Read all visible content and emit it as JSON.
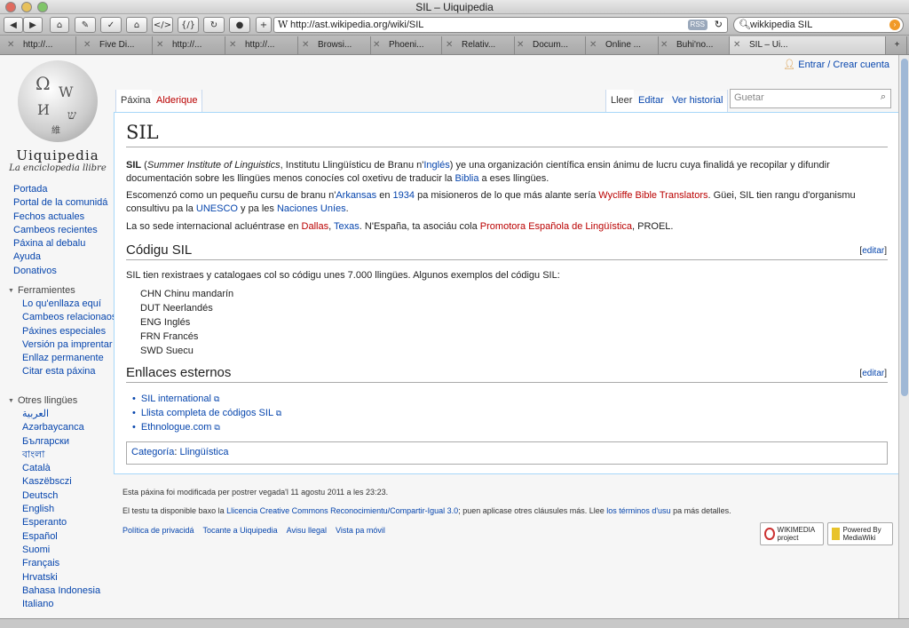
{
  "window": {
    "title": "SIL – Uiquipedia"
  },
  "toolbar": {
    "url": "http://ast.wikipedia.org/wiki/SIL",
    "search": "wikkipedia SIL",
    "rss": "RSS"
  },
  "tabs": [
    "http://...",
    "Five Di...",
    "http://...",
    "http://...",
    "Browsi...",
    "Phoeni...",
    "Relativ...",
    "Docum...",
    "Online ...",
    "Buhi'no...",
    "SIL – Ui..."
  ],
  "sidebar": {
    "logo_name": "Uiquipedia",
    "logo_tag": "La enciclopedia llibre",
    "nav": [
      "Portada",
      "Portal de la comunidá",
      "Fechos actuales",
      "Cambeos recientes",
      "Páxina al debalu",
      "Ayuda",
      "Donativos"
    ],
    "tools_heading": "Ferramientes",
    "tools": [
      "Lo qu'enllaza equí",
      "Cambeos relacionaos",
      "Páxines especiales",
      "Versión pa imprentar",
      "Enllaz permanente",
      "Citar esta páxina"
    ],
    "langs_heading": "Otres llingües",
    "langs": [
      "العربية",
      "Azərbaycanca",
      "Български",
      "বাংলা",
      "Català",
      "Kaszëbsczi",
      "Deutsch",
      "English",
      "Esperanto",
      "Español",
      "Suomi",
      "Français",
      "Hrvatski",
      "Bahasa Indonesia",
      "Italiano"
    ]
  },
  "usertools": {
    "login": "Entrar / Crear cuenta"
  },
  "page_tabs": {
    "page": "Páxina",
    "talk": "Alderique",
    "read": "Lleer",
    "edit": "Editar",
    "history": "Ver historial",
    "search_placeholder": "Guetar"
  },
  "article": {
    "title": "SIL",
    "intro_1": {
      "b": "SIL",
      "a": " (",
      "i": "Summer Institute of Linguistics",
      "c": ", Institutu Llingüísticu de Branu n'",
      "l1": "Inglés",
      "d": ") ye una organización científica ensin ánimu de lucru cuya finalidá ye recopilar y difundir documentación sobre les llingües menos conocíes col oxetivu de traducir la ",
      "l2": "Biblia",
      "e": " a eses llingües."
    },
    "intro_2": {
      "a": "Escomenzó como un pequeñu cursu de branu n'",
      "l1": "Arkansas",
      "b": " en ",
      "l2": "1934",
      "c": " pa misioneros de lo que más alante sería ",
      "l3": "Wycliffe Bible Translators",
      "d": ". Güei, SIL tien rangu d'organismu consultivu pa la ",
      "l4": "UNESCO",
      "e": " y pa les ",
      "l5": "Naciones Uníes",
      "f": "."
    },
    "intro_3": {
      "a": "La so sede internacional acluéntrase en ",
      "l1": "Dallas",
      "b": ", ",
      "l2": "Texas",
      "c": ". N'España, ta asociáu cola ",
      "l3": "Promotora Española de Lingüística",
      "d": ", PROEL."
    },
    "h_code": "Códigu SIL",
    "edit_label": "editar",
    "code_intro": "SIL tien rexistraes y catalogaes col so códigu unes 7.000 llingües. Algunos exemplos del códigu SIL:",
    "codes": [
      "CHN Chinu mandarín",
      "DUT Neerlandés",
      "ENG Inglés",
      "FRN Francés",
      "SWD Suecu"
    ],
    "h_links": "Enllaces esternos",
    "links": [
      "SIL international",
      "Llista completa de códigos SIL",
      "Ethnologue.com"
    ],
    "cat_label": "Categoría",
    "cat_value": "Llingüística"
  },
  "footer": {
    "modified": "Esta páxina foi modificada per postrer vegada'l 11 agostu 2011 a les 23:23.",
    "license_a": "El testu ta disponible baxo la ",
    "license_link": "Llicencia Creative Commons Reconocimientu/Compartir-Igual 3.0",
    "license_b": "; puen aplicase otres cláusules más. Llee ",
    "terms_link": "los términos d'usu",
    "license_c": " pa más detalles.",
    "links": [
      "Política de privacidá",
      "Tocante a Uiquipedia",
      "Avisu llegal",
      "Vista pa móvil"
    ],
    "badge1": "WIKIMEDIA project",
    "badge2": "Powered By MediaWiki"
  }
}
